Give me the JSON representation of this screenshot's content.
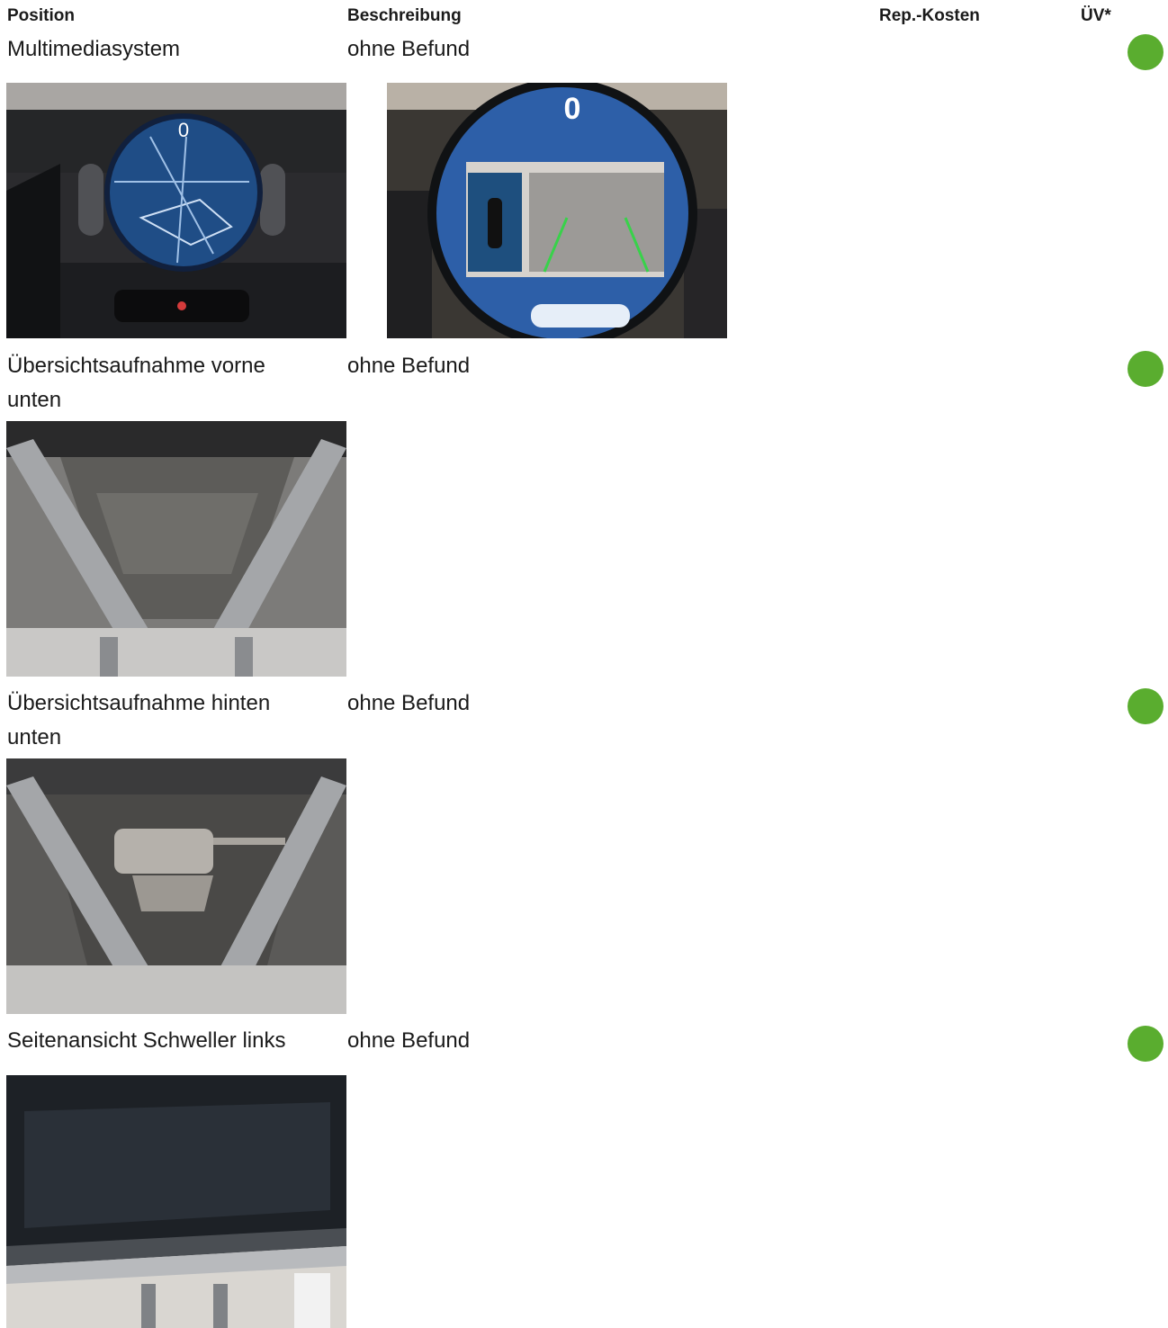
{
  "header": {
    "position": "Position",
    "description": "Beschreibung",
    "repair_cost": "Rep.-Kosten",
    "uv": "ÜV*"
  },
  "status_color": "#5aad2f",
  "rows": [
    {
      "position": "Multimediasystem",
      "description": "ohne Befund",
      "status": "ok",
      "photos": [
        "infotainment-navigation-photo",
        "infotainment-parking-camera-photo"
      ]
    },
    {
      "position": "Übersichtsaufnahme vorne unten",
      "description": "ohne Befund",
      "status": "ok",
      "photos": [
        "underbody-front-photo"
      ]
    },
    {
      "position": "Übersichtsaufnahme hinten unten",
      "description": "ohne Befund",
      "status": "ok",
      "photos": [
        "underbody-rear-photo"
      ]
    },
    {
      "position": "Seitenansicht Schweller links",
      "description": "ohne Befund",
      "status": "ok",
      "photos": [
        "sill-left-photo"
      ]
    }
  ]
}
